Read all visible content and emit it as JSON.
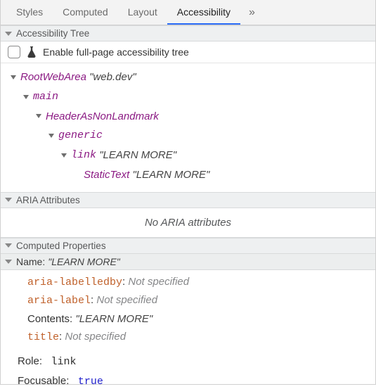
{
  "tabs": {
    "styles": "Styles",
    "computed": "Computed",
    "layout": "Layout",
    "accessibility": "Accessibility",
    "overflow": "»"
  },
  "sections": {
    "tree_header": "Accessibility Tree",
    "aria_header": "ARIA Attributes",
    "computed_header": "Computed Properties"
  },
  "enable": {
    "label": "Enable full-page accessibility tree"
  },
  "tree": {
    "n0_role": "RootWebArea",
    "n0_name": "\"web.dev\"",
    "n1_role": "main",
    "n2_role": "HeaderAsNonLandmark",
    "n3_role": "generic",
    "n4_role": "link",
    "n4_name": "\"LEARN MORE\"",
    "n5_role": "StaticText",
    "n5_name": "\"LEARN MORE\""
  },
  "aria": {
    "empty": "No ARIA attributes"
  },
  "computed": {
    "name_label": "Name:",
    "name_value": "\"LEARN MORE\"",
    "p0_key": "aria-labelledby",
    "p0_val": "Not specified",
    "p1_key": "aria-label",
    "p1_val": "Not specified",
    "p2_key": "Contents",
    "p2_val": "\"LEARN MORE\"",
    "p3_key": "title",
    "p3_val": "Not specified",
    "role_label": "Role:",
    "role_value": "link",
    "focusable_label": "Focusable:",
    "focusable_value": "true"
  }
}
